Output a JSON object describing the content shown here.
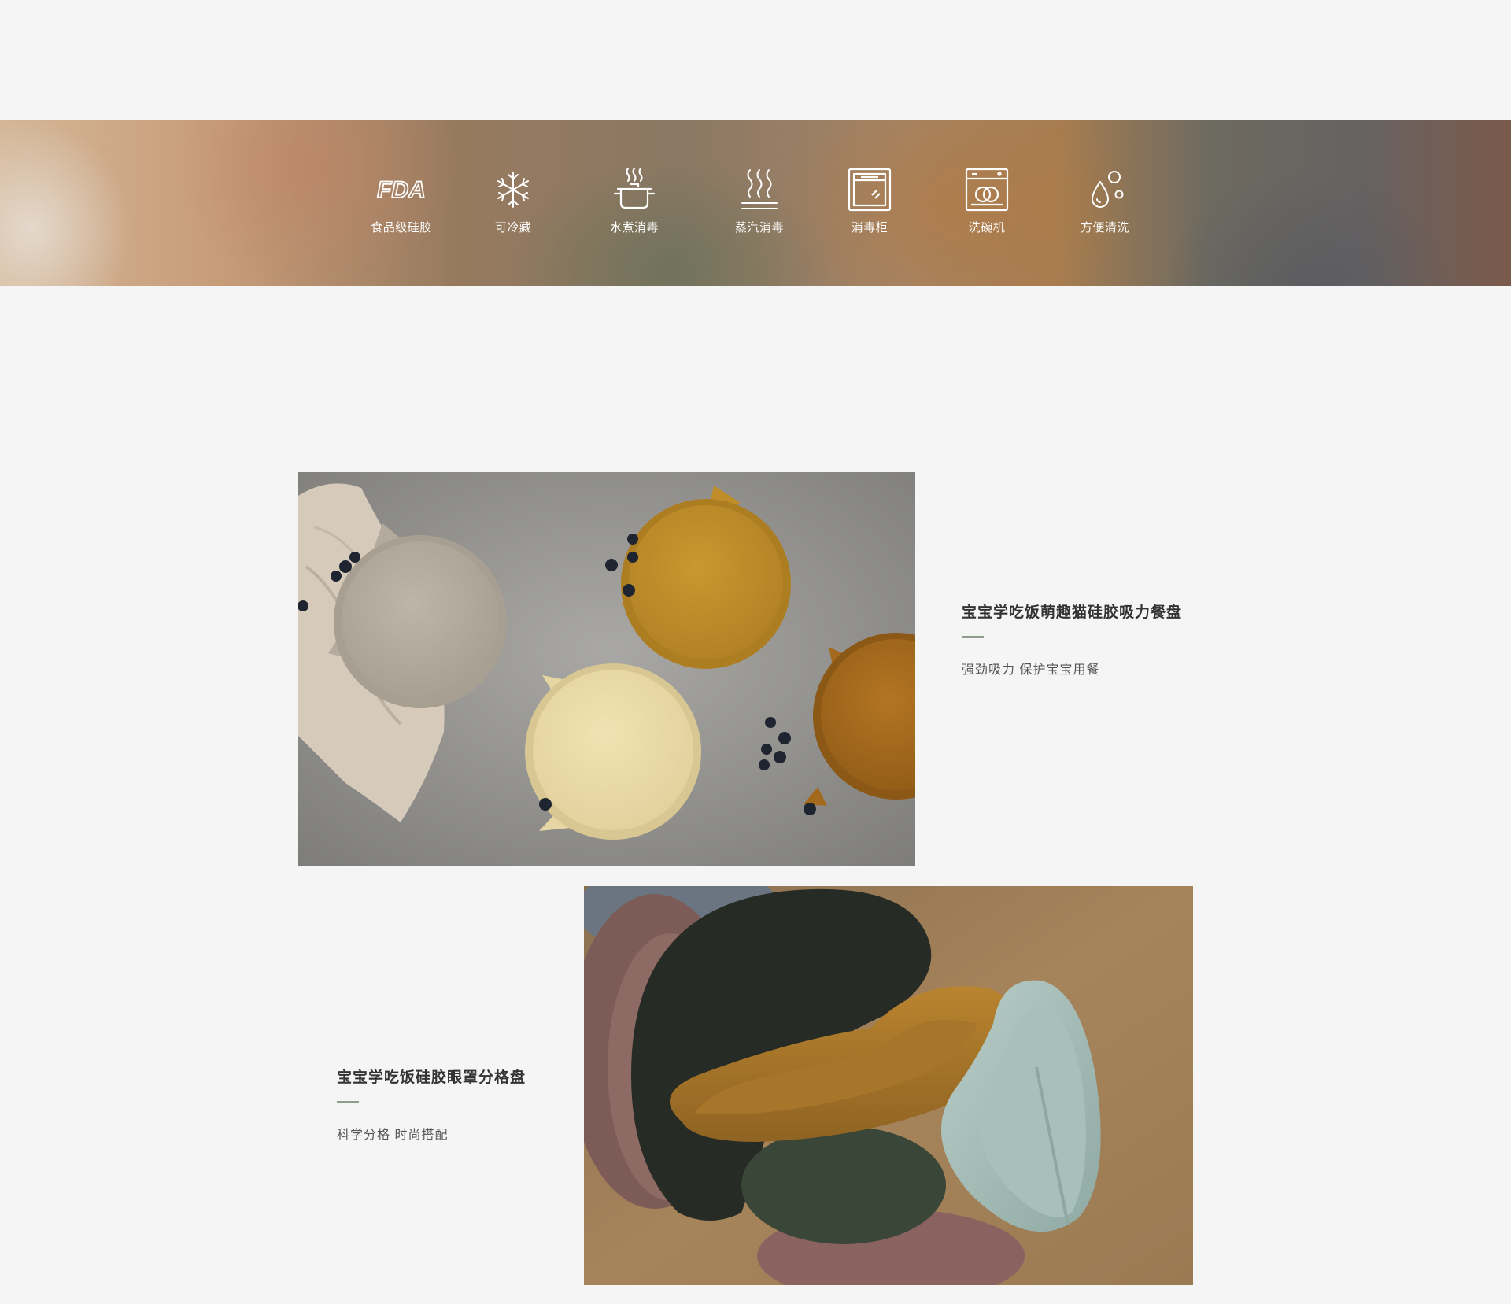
{
  "features": [
    {
      "icon": "fda-icon",
      "label": "食品级硅胶"
    },
    {
      "icon": "snowflake-icon",
      "label": "可冷藏"
    },
    {
      "icon": "boiling-pot-icon",
      "label": "水煮消毒"
    },
    {
      "icon": "steam-icon",
      "label": "蒸汽消毒"
    },
    {
      "icon": "sterilizer-cabinet-icon",
      "label": "消毒柜"
    },
    {
      "icon": "dishwasher-icon",
      "label": "洗碗机"
    },
    {
      "icon": "water-drops-icon",
      "label": "方便清洗"
    }
  ],
  "fda_text": "FDA",
  "products": [
    {
      "title": "宝宝学吃饭萌趣猫硅胶吸力餐盘",
      "subtitle": "强劲吸力  保护宝宝用餐",
      "image": "cat-plates-photo"
    },
    {
      "title": "宝宝学吃饭硅胶眼罩分格盘",
      "subtitle": "科学分格  时尚搭配",
      "image": "divided-plates-photo"
    }
  ],
  "colors": {
    "accent_rule": "#8f9e8e",
    "title": "#333333",
    "subtitle": "#555555",
    "background": "#f5f5f5"
  }
}
